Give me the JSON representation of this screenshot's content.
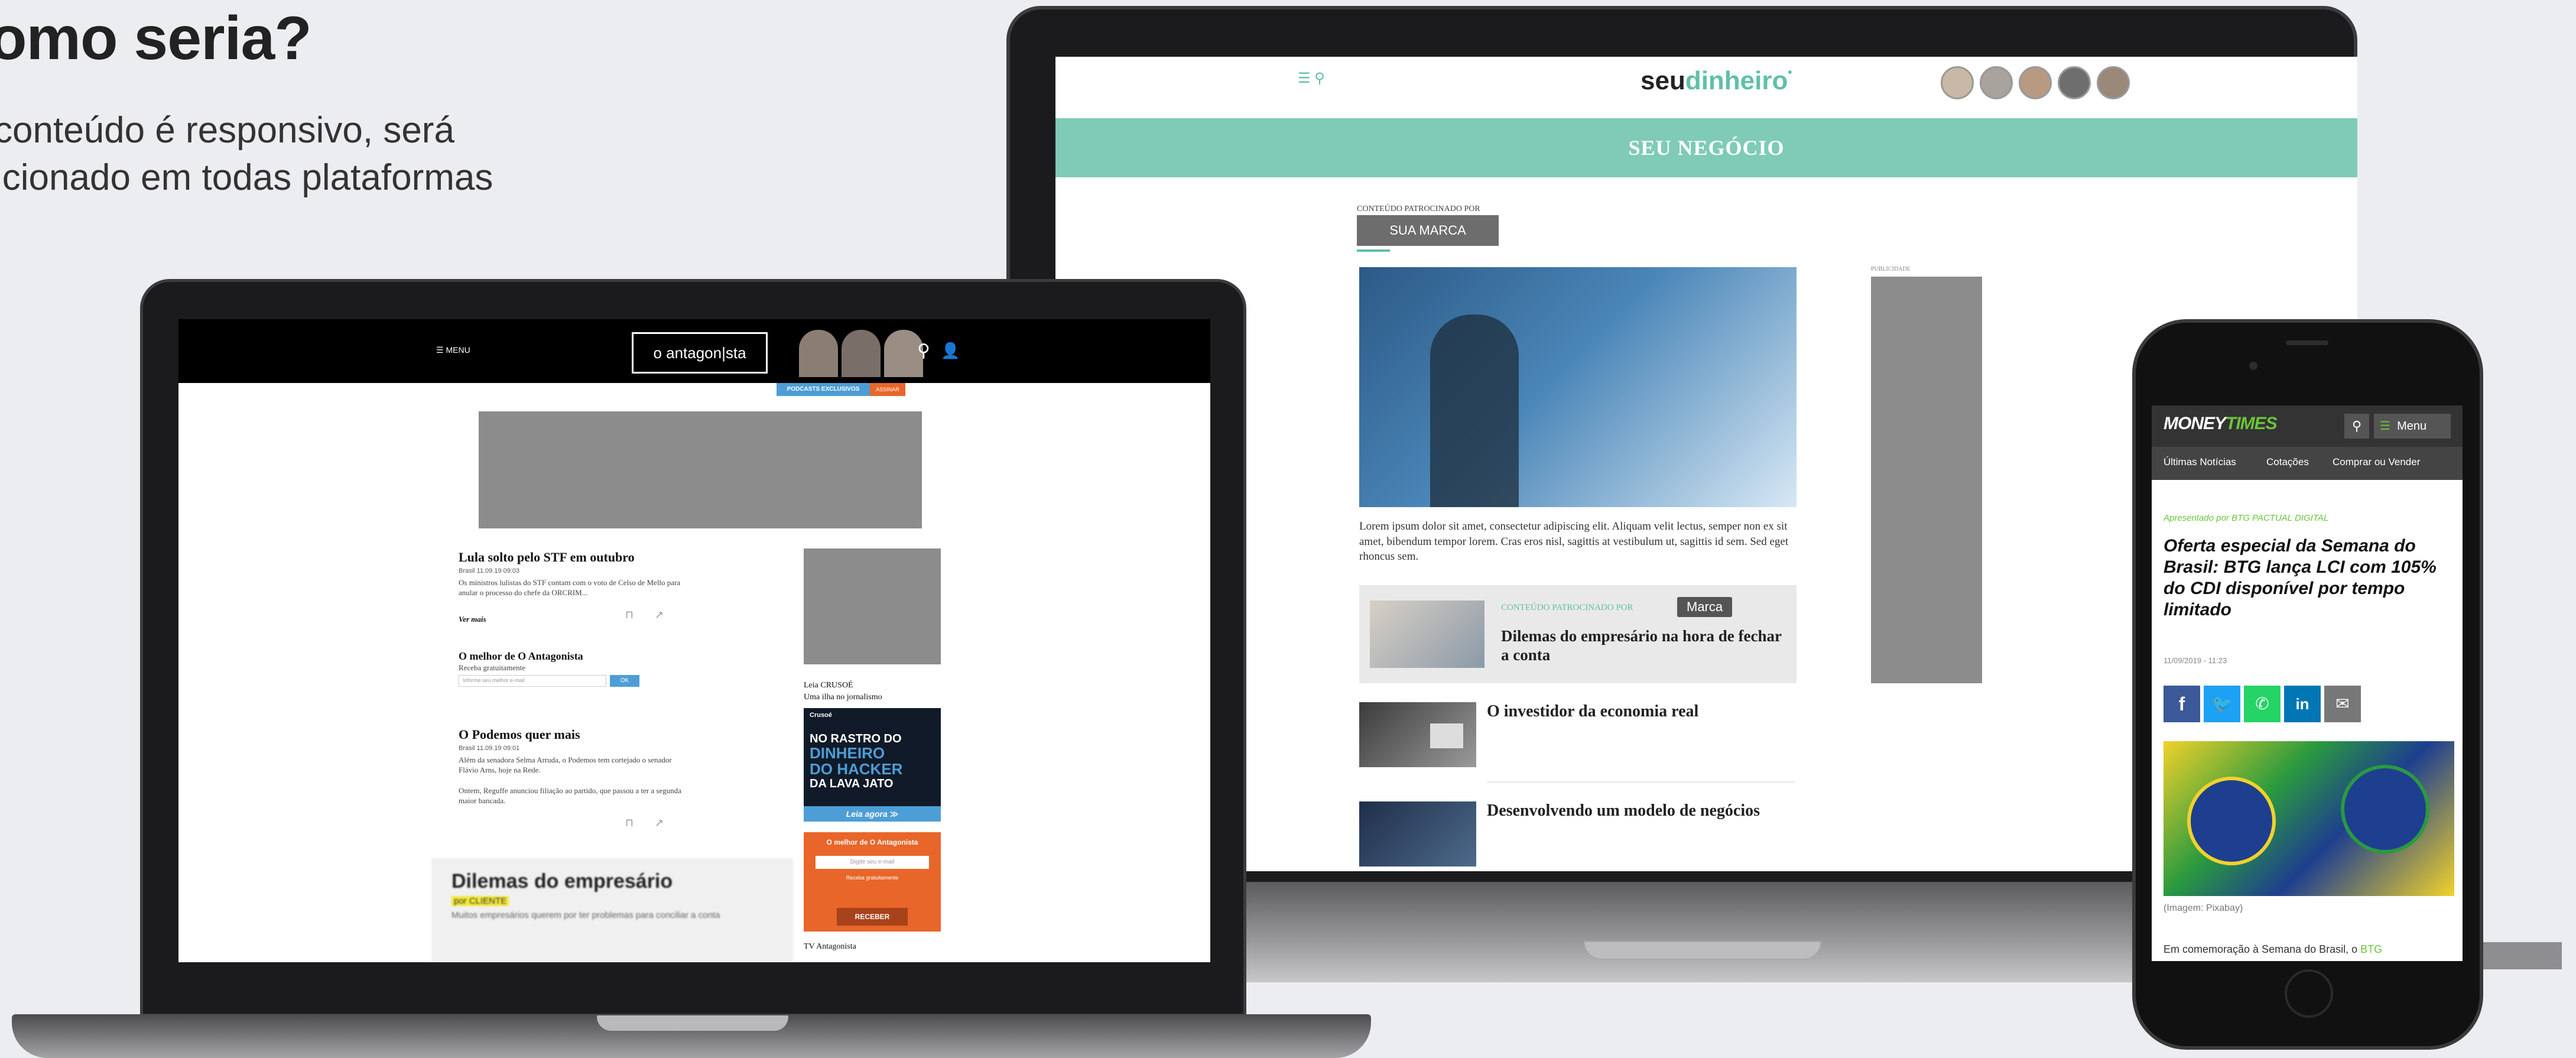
{
  "slide": {
    "heading": "omo seria?",
    "sub_line1": "conteúdo é responsivo, será",
    "sub_line2": "icionado em todas plataformas"
  },
  "seudinheiro": {
    "logo_part1": "seu",
    "logo_part2": "dinheiro",
    "banner": "SEU NEGÓCIO",
    "sponsored_label": "CONTEÚDO PATROCINADO POR",
    "brand_button": "SUA MARCA",
    "body_text": "Lorem ipsum dolor sit amet, consectetur adipiscing elit. Aliquam velit lectus, semper non ex sit amet, bibendum tempor lorem. Cras eros nisl, sagittis at vestibulum ut, sagittis id sem. Sed eget rhoncus sem.",
    "card_sponsored": "CONTEÚDO PATROCINADO POR",
    "card_brand": "Marca",
    "card_title": "Dilemas do empresário na hora de fechar a conta",
    "item2": "O investidor da economia real",
    "item3": "Desenvolvendo um modelo de negócios",
    "ad_label": "PUBLICIDADE",
    "colors": {
      "accent": "#5fc0a7",
      "brand_dark": "#222222",
      "ad_gray": "#8c8c8c"
    }
  },
  "antagonista": {
    "menu": "MENU",
    "logo": "o antagon|sta",
    "podcast": "PODCASTS EXCLUSIVOS",
    "podcast_tag": "ASSINAR",
    "article1_title": "Lula solto pelo STF em outubro",
    "article1_meta": "Brasil 11.09.19 09:03",
    "article1_text": "Os ministros lulistas do STF contam com o voto de Celso de Mello para anular o processo do chefe da ORCRIM...",
    "read_more": "Ver mais",
    "newsletter_title": "O melhor de O Antagonista",
    "newsletter_sub": "Receba gratuitamente",
    "newsletter_placeholder": "Informe seu melhor e-mail",
    "newsletter_ok": "OK",
    "article2_title": "O Podemos quer mais",
    "article2_meta": "Brasil 11.09.19 09:01",
    "article2_text1": "Além da senadora Selma Arruda, o Podemos tem cortejado o senador Flávio Arns, hoje na Rede.",
    "article2_text2": "Ontem, Reguffe anunciou filiação ao partido, que passou a ter a segunda maior bancada.",
    "promo_title": "Dilemas do empresário",
    "promo_tag": "por CLIENTE",
    "promo_text": "Muitos empresários querem por ter problemas para conciliar a conta",
    "side_label1": "Leia CRUSOÉ",
    "side_label2": "Uma ilha no jornalismo",
    "crusoe_brand": "Crusoé",
    "crusoe_l1": "NO RASTRO DO",
    "crusoe_l2": "DINHEIRO",
    "crusoe_l3": "DO HACKER",
    "crusoe_l4": "DA LAVA JATO",
    "crusoe_cta": "Leia agora ≫",
    "side_news_title": "O melhor de O Antagonista",
    "side_news_input": "Digite seu e-mail",
    "side_news_sub": "Receba gratuitamente",
    "side_news_btn": "RECEBER",
    "tv_label": "TV Antagonista",
    "colors": {
      "orange": "#e8662a",
      "topbar": "#000000",
      "ok_blue": "#4d9ed6"
    }
  },
  "moneytimes": {
    "logo_a": "MONEY",
    "logo_b": "TIMES",
    "menu": "Menu",
    "nav": [
      "Últimas Notícias",
      "Cotações",
      "Comprar ou Vender"
    ],
    "presented": "Apresentado por BTG PACTUAL DIGITAL",
    "title": "Oferta especial da Semana do Brasil: BTG lança LCI com 105% do CDI disponível por tempo limitado",
    "date": "11/09/2019 - 11:23",
    "caption": "(Imagem: Pixabay)",
    "body_start": "Em comemoração à Semana do Brasil, o ",
    "body_link": "BTG",
    "colors": {
      "green": "#6ac43b",
      "header": "#333333"
    }
  }
}
